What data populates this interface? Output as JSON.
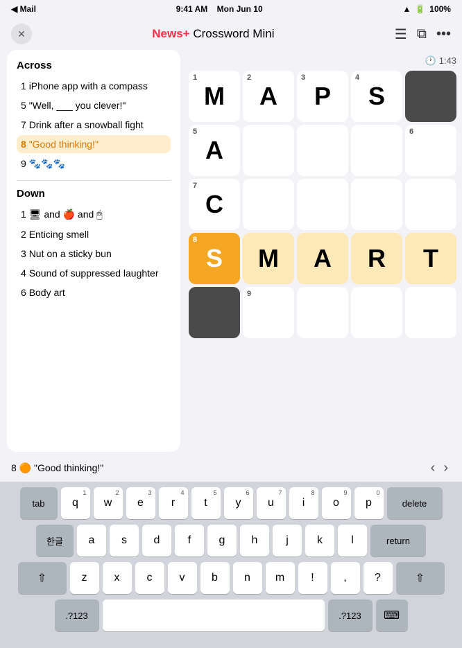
{
  "statusBar": {
    "carrier": "◀ Mail",
    "time": "9:41 AM",
    "date": "Mon Jun 10",
    "wifi": "WiFi",
    "battery": "100%"
  },
  "navBar": {
    "closeLabel": "✕",
    "titlePrefix": "Apple News+",
    "titleSuffix": "Crossword Mini",
    "listIcon": "≡",
    "shareIcon": "⊡",
    "moreIcon": "•••"
  },
  "timer": {
    "label": "🕐 1:43"
  },
  "clues": {
    "acrossTitle": "Across",
    "acrossItems": [
      {
        "number": "1",
        "text": "iPhone app with a compass"
      },
      {
        "number": "5",
        "text": "\"Well, ___ you clever!\""
      },
      {
        "number": "7",
        "text": "Drink after a snowball fight"
      },
      {
        "number": "8",
        "text": "\"Good thinking!\"",
        "active": true
      },
      {
        "number": "9",
        "text": "🐾 🐾 🐾"
      }
    ],
    "downTitle": "Down",
    "downItems": [
      {
        "number": "1",
        "text": "🖥 and 🍎 and 🖱"
      },
      {
        "number": "2",
        "text": "Enticing smell"
      },
      {
        "number": "3",
        "text": "Nut on a sticky bun"
      },
      {
        "number": "4",
        "text": "Sound of suppressed laughter"
      },
      {
        "number": "6",
        "text": "Body art"
      }
    ]
  },
  "grid": {
    "cells": [
      [
        {
          "num": "1",
          "letter": "M",
          "state": "normal"
        },
        {
          "num": "2",
          "letter": "A",
          "state": "normal"
        },
        {
          "num": "3",
          "letter": "P",
          "state": "normal"
        },
        {
          "num": "4",
          "letter": "S",
          "state": "normal"
        },
        {
          "num": "",
          "letter": "",
          "state": "black"
        }
      ],
      [
        {
          "num": "5",
          "letter": "A",
          "state": "normal"
        },
        {
          "num": "",
          "letter": "",
          "state": "normal"
        },
        {
          "num": "",
          "letter": "",
          "state": "normal"
        },
        {
          "num": "",
          "letter": "",
          "state": "normal"
        },
        {
          "num": "6",
          "letter": "",
          "state": "normal"
        }
      ],
      [
        {
          "num": "7",
          "letter": "C",
          "state": "normal"
        },
        {
          "num": "",
          "letter": "",
          "state": "normal"
        },
        {
          "num": "",
          "letter": "",
          "state": "normal"
        },
        {
          "num": "",
          "letter": "",
          "state": "normal"
        },
        {
          "num": "",
          "letter": "",
          "state": "normal"
        }
      ],
      [
        {
          "num": "8",
          "letter": "S",
          "state": "active-cell"
        },
        {
          "num": "",
          "letter": "M",
          "state": "active-row"
        },
        {
          "num": "",
          "letter": "A",
          "state": "active-row"
        },
        {
          "num": "",
          "letter": "R",
          "state": "active-row"
        },
        {
          "num": "",
          "letter": "T",
          "state": "active-row"
        }
      ],
      [
        {
          "num": "",
          "letter": "",
          "state": "black"
        },
        {
          "num": "9",
          "letter": "",
          "state": "normal"
        },
        {
          "num": "",
          "letter": "",
          "state": "normal"
        },
        {
          "num": "",
          "letter": "",
          "state": "normal"
        },
        {
          "num": "",
          "letter": "",
          "state": "normal"
        }
      ]
    ]
  },
  "hintBar": {
    "clueRef": "8",
    "emoji": "🟠",
    "clueText": "\"Good thinking!\"",
    "prevIcon": "‹",
    "nextIcon": "›"
  },
  "keyboard": {
    "row1": [
      "q",
      "w",
      "e",
      "r",
      "t",
      "y",
      "u",
      "i",
      "o",
      "p"
    ],
    "row1subs": [
      "",
      "",
      "",
      "",
      "",
      "",
      "",
      "",
      "",
      ""
    ],
    "row2": [
      "a",
      "s",
      "d",
      "f",
      "g",
      "h",
      "j",
      "k",
      "l"
    ],
    "row2subs": [
      "",
      "",
      "",
      "",
      "",
      "",
      "",
      "",
      ""
    ],
    "row3": [
      "z",
      "x",
      "c",
      "v",
      "b",
      "n",
      "m",
      "!",
      ",",
      "?"
    ],
    "row3subs": [
      "",
      "",
      "",
      "",
      "",
      "",
      "",
      "",
      "",
      ""
    ],
    "tabLabel": "tab",
    "hangulLabel": "한글",
    "deleteLabel": "delete",
    "returnLabel": "return",
    "shiftLabel": "shift",
    "numLabel": ".?123",
    "numLabel2": ".?123",
    "spaceLabel": ""
  }
}
